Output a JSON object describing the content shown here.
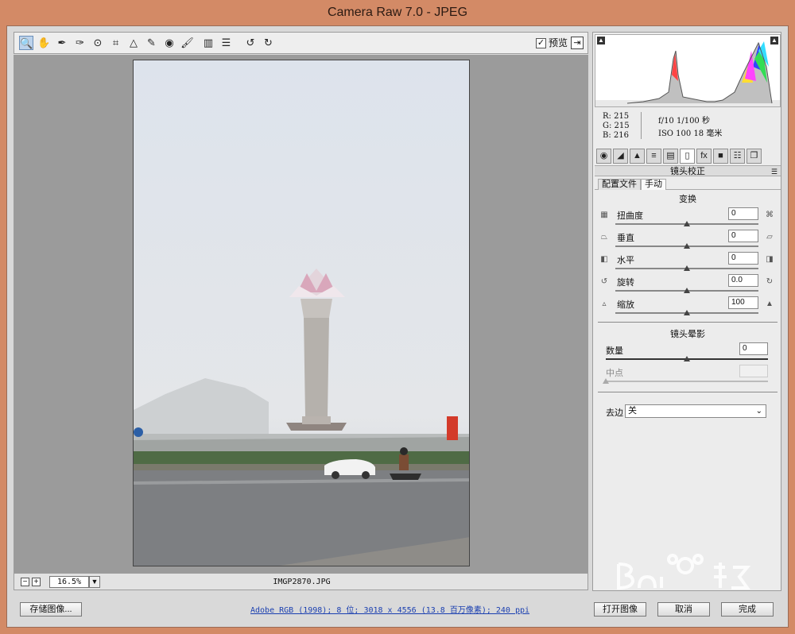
{
  "window": {
    "title": "Camera Raw 7.0 -  JPEG"
  },
  "toolbar": {
    "tools": [
      {
        "name": "zoom-tool",
        "glyph": "🔍"
      },
      {
        "name": "hand-tool",
        "glyph": "✋"
      },
      {
        "name": "white-balance-tool",
        "glyph": "✒"
      },
      {
        "name": "color-sampler-tool",
        "glyph": "✑"
      },
      {
        "name": "targeted-adjustment-tool",
        "glyph": "⊙"
      },
      {
        "name": "crop-tool",
        "glyph": "⌗"
      },
      {
        "name": "straighten-tool",
        "glyph": "△"
      },
      {
        "name": "spot-removal-tool",
        "glyph": "✎"
      },
      {
        "name": "red-eye-tool",
        "glyph": "◉"
      },
      {
        "name": "adjustment-brush-tool",
        "glyph": "🖌"
      },
      {
        "name": "graduated-filter-tool",
        "glyph": "▥"
      },
      {
        "name": "preferences-tool",
        "glyph": "☰"
      },
      {
        "name": "rotate-ccw-tool",
        "glyph": "↺"
      },
      {
        "name": "rotate-cw-tool",
        "glyph": "↻"
      }
    ],
    "preview_label": "预览",
    "preview_checked": "✓"
  },
  "status": {
    "zoom_minus": "−",
    "zoom_plus": "+",
    "zoom": "16.5%",
    "filename": "IMGP2870.JPG"
  },
  "info": {
    "r": "R:  215",
    "g": "G:  215",
    "b": "B:  216",
    "exif1": "f/10  1/100 秒",
    "exif2": "ISO 100  18 毫米"
  },
  "panel_tabs": [
    {
      "name": "basic-tab-icon",
      "glyph": "◉"
    },
    {
      "name": "tone-curve-tab-icon",
      "glyph": "◢"
    },
    {
      "name": "detail-tab-icon",
      "glyph": "▲"
    },
    {
      "name": "hsl-tab-icon",
      "glyph": "≡"
    },
    {
      "name": "split-toning-tab-icon",
      "glyph": "▤"
    },
    {
      "name": "lens-corrections-tab-icon",
      "glyph": "▯"
    },
    {
      "name": "effects-tab-icon",
      "glyph": "fx"
    },
    {
      "name": "camera-calibration-tab-icon",
      "glyph": "■"
    },
    {
      "name": "presets-tab-icon",
      "glyph": "☷"
    },
    {
      "name": "snapshots-tab-icon",
      "glyph": "❐"
    }
  ],
  "panel": {
    "title": "镜头校正",
    "menu_icon": "☰",
    "subtabs": [
      "配置文件",
      "手动"
    ],
    "transform_title": "变换",
    "controls": [
      {
        "label": "扭曲度",
        "value": "0",
        "pos": 0.5,
        "icon_l": "▦",
        "icon_r": "⌘"
      },
      {
        "label": "垂直",
        "value": "0",
        "pos": 0.5,
        "icon_l": "⏢",
        "icon_r": "⏥"
      },
      {
        "label": "水平",
        "value": "0",
        "pos": 0.5,
        "icon_l": "◧",
        "icon_r": "◨"
      },
      {
        "label": "旋转",
        "value": "0.0",
        "pos": 0.5,
        "icon_l": "↺",
        "icon_r": "↻"
      },
      {
        "label": "缩放",
        "value": "100",
        "pos": 0.5,
        "icon_l": "▵",
        "icon_r": "▲"
      }
    ],
    "vignette_title": "镜头晕影",
    "amount_label": "数量",
    "amount_value": "0",
    "amount_pos": 0.5,
    "midpoint_label": "中点",
    "defringe_label": "去边",
    "defringe_value": "关",
    "dropdown_arrow": "⌄"
  },
  "buttons": {
    "save": "存储图像...",
    "open": "打开图像",
    "cancel": "取消",
    "done": "完成"
  },
  "doc_info": "Adobe RGB (1998); 8 位; 3018 x 4556 (13.8 百万像素); 240 ppi",
  "colors": {
    "accent": "#d38a66",
    "link": "#1a3fb0"
  }
}
